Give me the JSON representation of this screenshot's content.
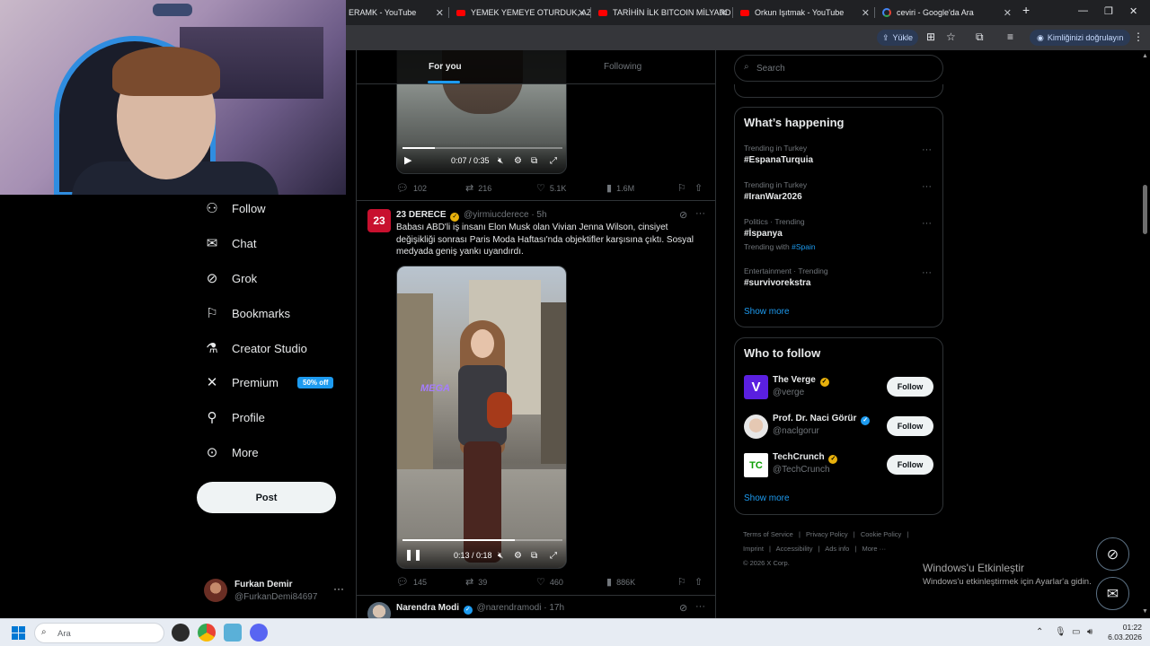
{
  "browser": {
    "tabs": [
      {
        "label": "ERAMK - YouTube",
        "type": "youtube"
      },
      {
        "label": "YEMEK YEMEYE OTURDUK, AZ",
        "type": "youtube"
      },
      {
        "label": "TARİHİN İLK BITCOIN MİLYARD",
        "type": "youtube"
      },
      {
        "label": "Orkun Işıtmak - YouTube",
        "type": "youtube"
      },
      {
        "label": "ceviri - Google'da Ara",
        "type": "google"
      }
    ],
    "new_tab_label": "+",
    "upload_label": "Yükle",
    "verify_label": "Kimliğinizi doğrulayın"
  },
  "nav": {
    "items": [
      {
        "label": "Follow",
        "icon": "person-add-icon"
      },
      {
        "label": "Chat",
        "icon": "envelope-icon"
      },
      {
        "label": "Grok",
        "icon": "grok-icon"
      },
      {
        "label": "Bookmarks",
        "icon": "bookmark-icon"
      },
      {
        "label": "Creator Studio",
        "icon": "flask-icon"
      },
      {
        "label": "Premium",
        "icon": "x-logo-icon",
        "badge": "50% off"
      },
      {
        "label": "Profile",
        "icon": "person-icon"
      },
      {
        "label": "More",
        "icon": "more-circle-icon"
      }
    ],
    "post_label": "Post",
    "account": {
      "name": "Furkan Demir",
      "handle": "@FurkanDemi84697"
    }
  },
  "feed": {
    "tabs": [
      "For you",
      "Following"
    ],
    "active_tab": "For you",
    "tweet1": {
      "video_time": "0:07 / 0:35",
      "video_progress": 0.2,
      "stats": {
        "replies": "102",
        "reposts": "216",
        "likes": "5.1K",
        "views": "1.6M"
      }
    },
    "tweet2": {
      "name": "23 DERECE",
      "handle": "@yirmiucderece",
      "time": "· 5h",
      "avatar_text": "23",
      "text": "Babası ABD'li iş insanı Elon Musk olan Vivian Jenna Wilson, cinsiyet değişikliği sonrası Paris Moda Haftası'nda objektifler karşısına çıktı. Sosyal medyada geniş yankı uyandırdı.",
      "video_overlay": "MEGA",
      "video_time": "0:13 / 0:18",
      "video_progress": 0.7,
      "stats": {
        "replies": "145",
        "reposts": "39",
        "likes": "460",
        "views": "886K"
      }
    },
    "tweet3": {
      "name": "Narendra Modi",
      "handle": "@narendramodi",
      "time": "· 17h"
    }
  },
  "sidebar": {
    "search_placeholder": "Search",
    "happening": {
      "title": "What’s happening",
      "trends": [
        {
          "meta": "Trending in Turkey",
          "tag": "#EspanaTurquia"
        },
        {
          "meta": "Trending in Turkey",
          "tag": "#IranWar2026"
        },
        {
          "meta": "Politics · Trending",
          "tag": "#İspanya",
          "with_label": "Trending with",
          "with_tag": "#Spain"
        },
        {
          "meta": "Entertainment · Trending",
          "tag": "#survivorekstra"
        }
      ],
      "show_more": "Show more"
    },
    "who_to_follow": {
      "title": "Who to follow",
      "accounts": [
        {
          "name": "The Verge",
          "handle": "@verge",
          "avatar_text": "V"
        },
        {
          "name": "Prof. Dr. Naci Görür",
          "handle": "@naclgorur"
        },
        {
          "name": "TechCrunch",
          "handle": "@TechCrunch",
          "avatar_text": "TC"
        }
      ],
      "follow_label": "Follow",
      "show_more": "Show more"
    },
    "footer": {
      "links": [
        "Terms of Service",
        "|",
        "Privacy Policy",
        "|",
        "Cookie Policy",
        "|",
        "Imprint",
        "|",
        "Accessibility",
        "|",
        "Ads info",
        "|",
        "More ···"
      ],
      "copyright": "© 2026 X Corp."
    }
  },
  "windows": {
    "activate_title": "Windows'u Etkinleştir",
    "activate_text": "Windows'u etkinleştirmek için Ayarlar'a gidin.",
    "search_placeholder": "Ara",
    "time": "01:22",
    "date": "6.03.2026"
  }
}
